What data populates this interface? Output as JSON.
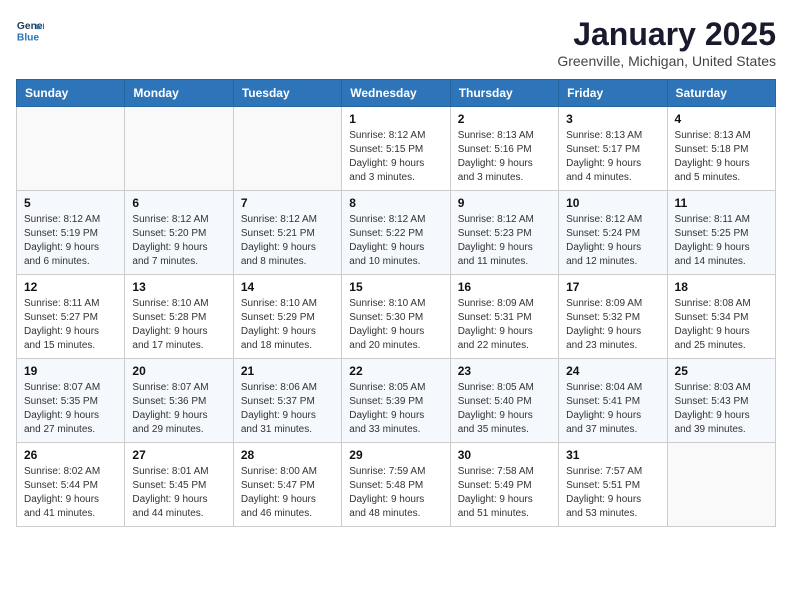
{
  "header": {
    "logo_line1": "General",
    "logo_line2": "Blue",
    "month_title": "January 2025",
    "location": "Greenville, Michigan, United States"
  },
  "weekdays": [
    "Sunday",
    "Monday",
    "Tuesday",
    "Wednesday",
    "Thursday",
    "Friday",
    "Saturday"
  ],
  "weeks": [
    [
      {
        "day": "",
        "info": ""
      },
      {
        "day": "",
        "info": ""
      },
      {
        "day": "",
        "info": ""
      },
      {
        "day": "1",
        "info": "Sunrise: 8:12 AM\nSunset: 5:15 PM\nDaylight: 9 hours and 3 minutes."
      },
      {
        "day": "2",
        "info": "Sunrise: 8:13 AM\nSunset: 5:16 PM\nDaylight: 9 hours and 3 minutes."
      },
      {
        "day": "3",
        "info": "Sunrise: 8:13 AM\nSunset: 5:17 PM\nDaylight: 9 hours and 4 minutes."
      },
      {
        "day": "4",
        "info": "Sunrise: 8:13 AM\nSunset: 5:18 PM\nDaylight: 9 hours and 5 minutes."
      }
    ],
    [
      {
        "day": "5",
        "info": "Sunrise: 8:12 AM\nSunset: 5:19 PM\nDaylight: 9 hours and 6 minutes."
      },
      {
        "day": "6",
        "info": "Sunrise: 8:12 AM\nSunset: 5:20 PM\nDaylight: 9 hours and 7 minutes."
      },
      {
        "day": "7",
        "info": "Sunrise: 8:12 AM\nSunset: 5:21 PM\nDaylight: 9 hours and 8 minutes."
      },
      {
        "day": "8",
        "info": "Sunrise: 8:12 AM\nSunset: 5:22 PM\nDaylight: 9 hours and 10 minutes."
      },
      {
        "day": "9",
        "info": "Sunrise: 8:12 AM\nSunset: 5:23 PM\nDaylight: 9 hours and 11 minutes."
      },
      {
        "day": "10",
        "info": "Sunrise: 8:12 AM\nSunset: 5:24 PM\nDaylight: 9 hours and 12 minutes."
      },
      {
        "day": "11",
        "info": "Sunrise: 8:11 AM\nSunset: 5:25 PM\nDaylight: 9 hours and 14 minutes."
      }
    ],
    [
      {
        "day": "12",
        "info": "Sunrise: 8:11 AM\nSunset: 5:27 PM\nDaylight: 9 hours and 15 minutes."
      },
      {
        "day": "13",
        "info": "Sunrise: 8:10 AM\nSunset: 5:28 PM\nDaylight: 9 hours and 17 minutes."
      },
      {
        "day": "14",
        "info": "Sunrise: 8:10 AM\nSunset: 5:29 PM\nDaylight: 9 hours and 18 minutes."
      },
      {
        "day": "15",
        "info": "Sunrise: 8:10 AM\nSunset: 5:30 PM\nDaylight: 9 hours and 20 minutes."
      },
      {
        "day": "16",
        "info": "Sunrise: 8:09 AM\nSunset: 5:31 PM\nDaylight: 9 hours and 22 minutes."
      },
      {
        "day": "17",
        "info": "Sunrise: 8:09 AM\nSunset: 5:32 PM\nDaylight: 9 hours and 23 minutes."
      },
      {
        "day": "18",
        "info": "Sunrise: 8:08 AM\nSunset: 5:34 PM\nDaylight: 9 hours and 25 minutes."
      }
    ],
    [
      {
        "day": "19",
        "info": "Sunrise: 8:07 AM\nSunset: 5:35 PM\nDaylight: 9 hours and 27 minutes."
      },
      {
        "day": "20",
        "info": "Sunrise: 8:07 AM\nSunset: 5:36 PM\nDaylight: 9 hours and 29 minutes."
      },
      {
        "day": "21",
        "info": "Sunrise: 8:06 AM\nSunset: 5:37 PM\nDaylight: 9 hours and 31 minutes."
      },
      {
        "day": "22",
        "info": "Sunrise: 8:05 AM\nSunset: 5:39 PM\nDaylight: 9 hours and 33 minutes."
      },
      {
        "day": "23",
        "info": "Sunrise: 8:05 AM\nSunset: 5:40 PM\nDaylight: 9 hours and 35 minutes."
      },
      {
        "day": "24",
        "info": "Sunrise: 8:04 AM\nSunset: 5:41 PM\nDaylight: 9 hours and 37 minutes."
      },
      {
        "day": "25",
        "info": "Sunrise: 8:03 AM\nSunset: 5:43 PM\nDaylight: 9 hours and 39 minutes."
      }
    ],
    [
      {
        "day": "26",
        "info": "Sunrise: 8:02 AM\nSunset: 5:44 PM\nDaylight: 9 hours and 41 minutes."
      },
      {
        "day": "27",
        "info": "Sunrise: 8:01 AM\nSunset: 5:45 PM\nDaylight: 9 hours and 44 minutes."
      },
      {
        "day": "28",
        "info": "Sunrise: 8:00 AM\nSunset: 5:47 PM\nDaylight: 9 hours and 46 minutes."
      },
      {
        "day": "29",
        "info": "Sunrise: 7:59 AM\nSunset: 5:48 PM\nDaylight: 9 hours and 48 minutes."
      },
      {
        "day": "30",
        "info": "Sunrise: 7:58 AM\nSunset: 5:49 PM\nDaylight: 9 hours and 51 minutes."
      },
      {
        "day": "31",
        "info": "Sunrise: 7:57 AM\nSunset: 5:51 PM\nDaylight: 9 hours and 53 minutes."
      },
      {
        "day": "",
        "info": ""
      }
    ]
  ]
}
